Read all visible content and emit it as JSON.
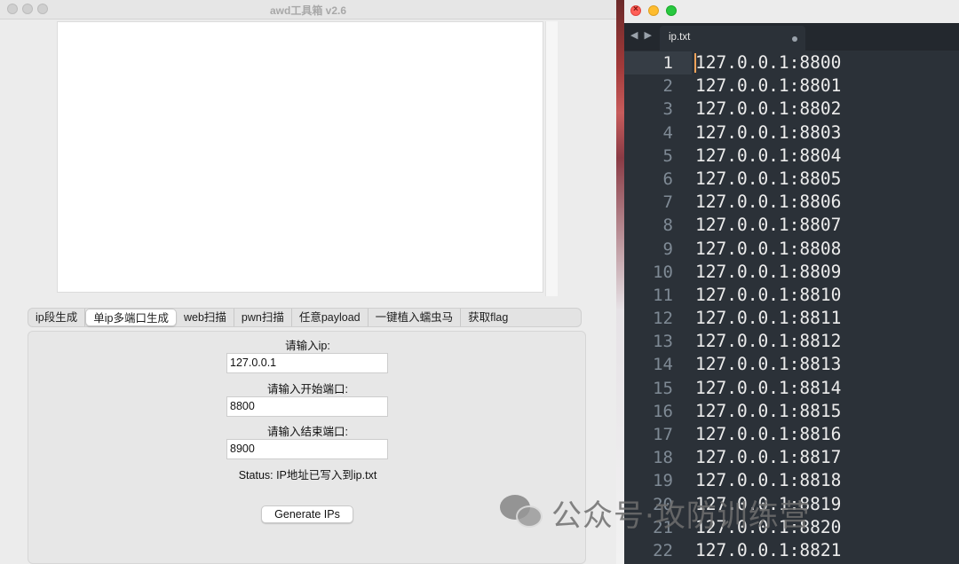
{
  "left_window": {
    "title": "awd工具箱 v2.6",
    "tabs": [
      {
        "label": "ip段生成",
        "active": false
      },
      {
        "label": "单ip多端口生成",
        "active": true
      },
      {
        "label": "web扫描",
        "active": false
      },
      {
        "label": "pwn扫描",
        "active": false
      },
      {
        "label": "任意payload",
        "active": false
      },
      {
        "label": "一键植入蠕虫马",
        "active": false
      },
      {
        "label": "获取flag",
        "active": false
      }
    ],
    "form": {
      "ip_label": "请输入ip:",
      "ip_value": "127.0.0.1",
      "start_port_label": "请输入开始端口:",
      "start_port_value": "8800",
      "end_port_label": "请输入结束端口:",
      "end_port_value": "8900",
      "status": "Status: IP地址已写入到ip.txt",
      "generate_button": "Generate IPs"
    }
  },
  "right_window": {
    "nav_arrows": "◀ ▶",
    "file_tab": "ip.txt",
    "current_line": 1,
    "lines": [
      "127.0.0.1:8800",
      "127.0.0.1:8801",
      "127.0.0.1:8802",
      "127.0.0.1:8803",
      "127.0.0.1:8804",
      "127.0.0.1:8805",
      "127.0.0.1:8806",
      "127.0.0.1:8807",
      "127.0.0.1:8808",
      "127.0.0.1:8809",
      "127.0.0.1:8810",
      "127.0.0.1:8811",
      "127.0.0.1:8812",
      "127.0.0.1:8813",
      "127.0.0.1:8814",
      "127.0.0.1:8815",
      "127.0.0.1:8816",
      "127.0.0.1:8817",
      "127.0.0.1:8818",
      "127.0.0.1:8819",
      "127.0.0.1:8820",
      "127.0.0.1:8821"
    ]
  },
  "watermark": {
    "text": "公众号·攻防训练营",
    "icon": "wechat-icon"
  },
  "colors": {
    "editor_bg": "#2b3138",
    "cursor": "#f0a35a",
    "close": "#ff5f57",
    "minimize": "#febc2e",
    "zoom": "#28c840"
  }
}
